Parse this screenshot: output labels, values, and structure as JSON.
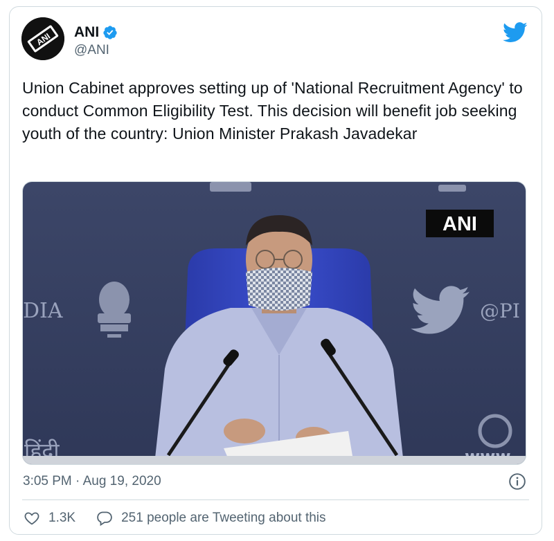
{
  "tweet": {
    "author_name": "ANI",
    "author_handle": "@ANI",
    "avatar_text": "ANI",
    "text": "Union Cabinet approves setting up of 'National Recruitment Agency' to conduct Common Eligibility Test. This decision will benefit job seeking youth of the country: Union Minister Prakash Javadekar",
    "timestamp": "3:05 PM · Aug 19, 2020",
    "likes": "1.3K",
    "reply_text": "251 people are Tweeting about this"
  },
  "media": {
    "watermark": "ANI",
    "backdrop_left": "DIA",
    "backdrop_right": "@PI",
    "backdrop_hindi": "हिंदी",
    "backdrop_www": "www"
  },
  "colors": {
    "brand": "#1d9bf0",
    "text_primary": "#0f1419",
    "text_secondary": "#536471",
    "border": "#cfd9de"
  },
  "icons": [
    "ani-logo",
    "verified-badge-icon",
    "twitter-bird-icon",
    "info-icon",
    "heart-icon",
    "reply-icon"
  ]
}
